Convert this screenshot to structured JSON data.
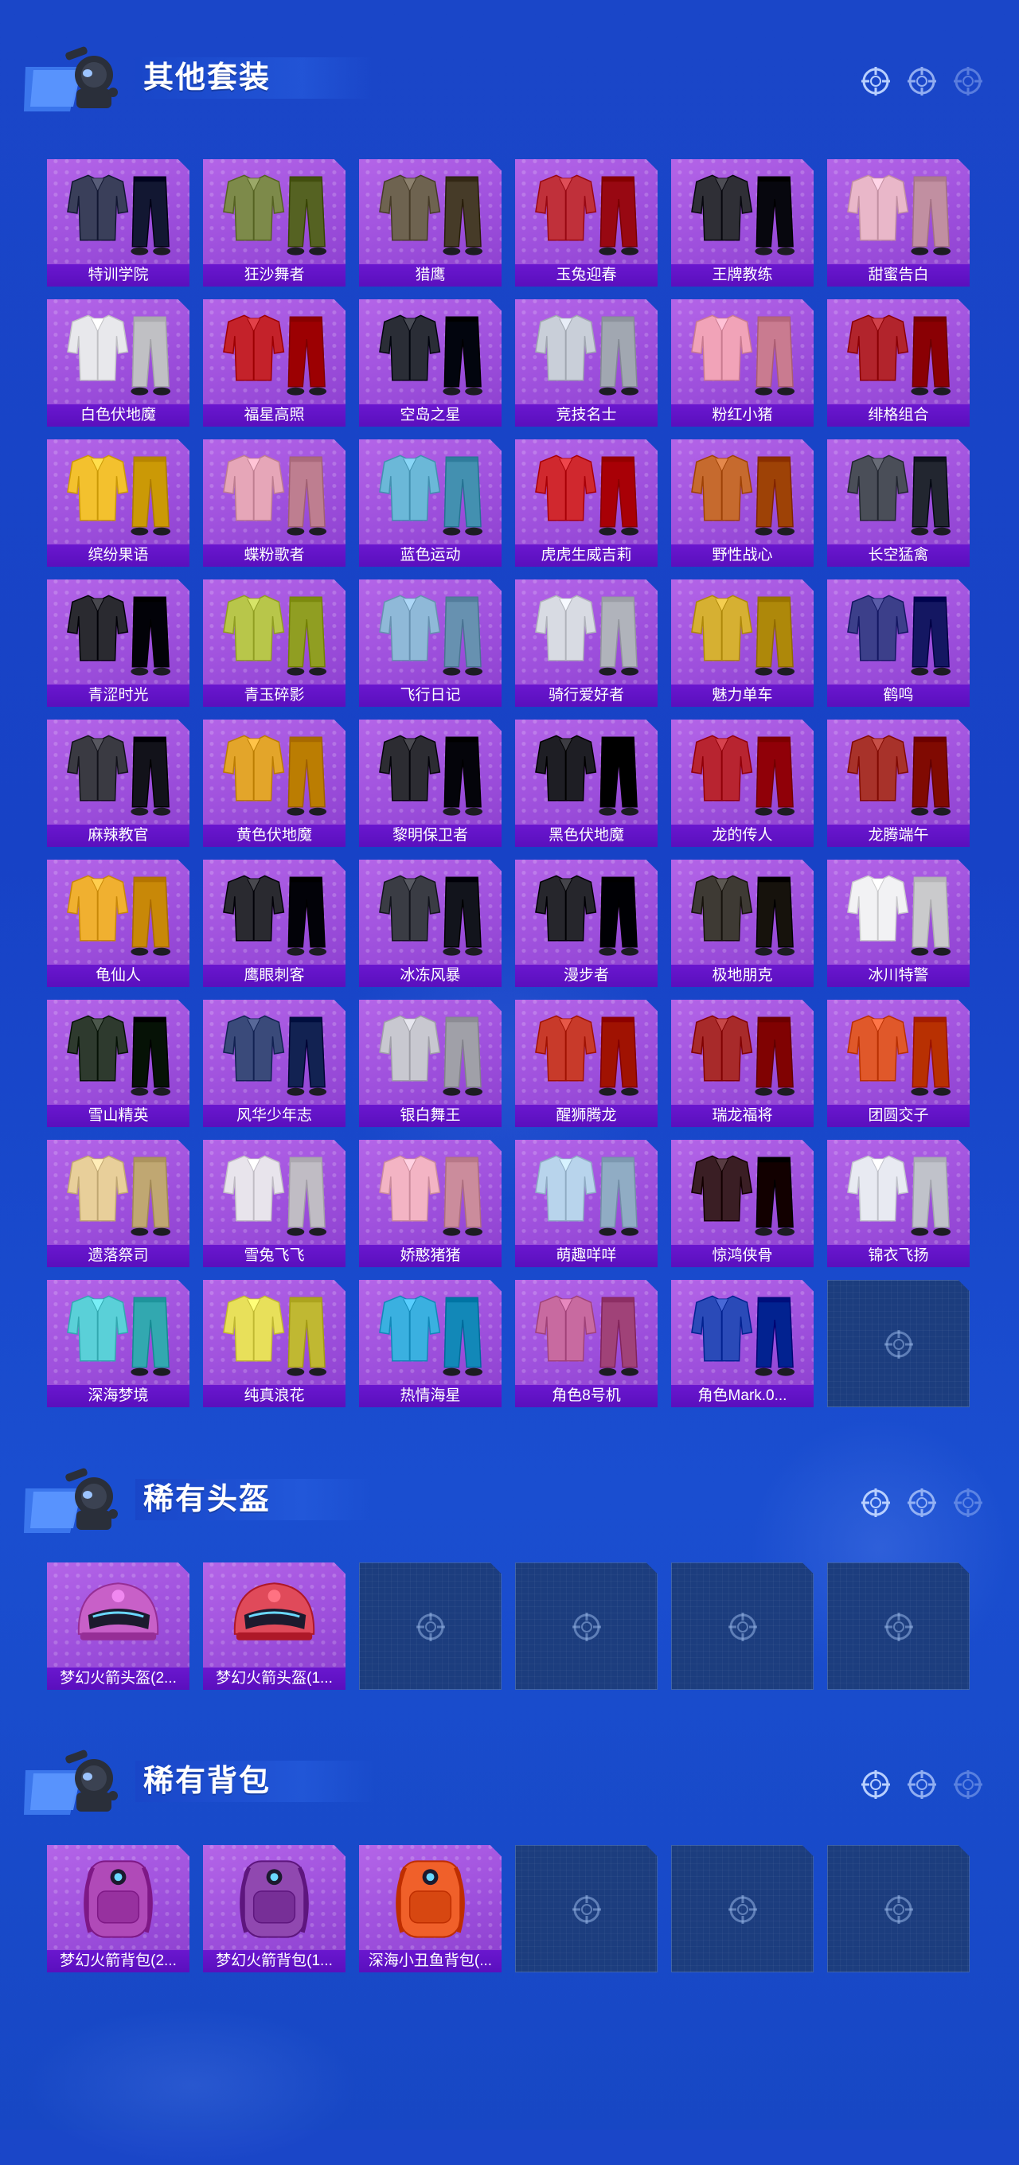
{
  "sections": [
    {
      "title": "其他套装",
      "items": [
        {
          "label": "特训学院",
          "kind": "outfit",
          "color": "#3a3f5a"
        },
        {
          "label": "狂沙舞者",
          "kind": "outfit",
          "color": "#7d8a4a"
        },
        {
          "label": "猎鹰",
          "kind": "outfit",
          "color": "#6e6350"
        },
        {
          "label": "玉兔迎春",
          "kind": "outfit",
          "color": "#c0303a"
        },
        {
          "label": "王牌教练",
          "kind": "outfit",
          "color": "#2f2f36"
        },
        {
          "label": "甜蜜告白",
          "kind": "outfit",
          "color": "#e9b7c9"
        },
        {
          "label": "白色伏地魔",
          "kind": "outfit",
          "color": "#e8e8ec"
        },
        {
          "label": "福星高照",
          "kind": "outfit",
          "color": "#c4222a"
        },
        {
          "label": "空岛之星",
          "kind": "outfit",
          "color": "#2a2d36"
        },
        {
          "label": "竞技名士",
          "kind": "outfit",
          "color": "#c9cfd9"
        },
        {
          "label": "粉红小猪",
          "kind": "outfit",
          "color": "#f1a3b8"
        },
        {
          "label": "绯格组合",
          "kind": "outfit",
          "color": "#b2242c"
        },
        {
          "label": "缤纷果语",
          "kind": "outfit",
          "color": "#f3c12e"
        },
        {
          "label": "蝶粉歌者",
          "kind": "outfit",
          "color": "#e6a6b8"
        },
        {
          "label": "蓝色运动",
          "kind": "outfit",
          "color": "#6bb8d8"
        },
        {
          "label": "虎虎生威吉莉",
          "kind": "outfit",
          "color": "#d0282e"
        },
        {
          "label": "野性战心",
          "kind": "outfit",
          "color": "#c66a2e"
        },
        {
          "label": "长空猛禽",
          "kind": "outfit",
          "color": "#4a4e58"
        },
        {
          "label": "青涩时光",
          "kind": "outfit",
          "color": "#2a2a30"
        },
        {
          "label": "青玉碎影",
          "kind": "outfit",
          "color": "#b8c64a"
        },
        {
          "label": "飞行日记",
          "kind": "outfit",
          "color": "#8fb9d8"
        },
        {
          "label": "骑行爱好者",
          "kind": "outfit",
          "color": "#d8dbe3"
        },
        {
          "label": "魅力单车",
          "kind": "outfit",
          "color": "#d6b032"
        },
        {
          "label": "鹤鸣",
          "kind": "outfit",
          "color": "#3c3f8a"
        },
        {
          "label": "麻辣教官",
          "kind": "outfit",
          "color": "#3a3a42"
        },
        {
          "label": "黄色伏地魔",
          "kind": "outfit",
          "color": "#e3a52a"
        },
        {
          "label": "黎明保卫者",
          "kind": "outfit",
          "color": "#2c2c32"
        },
        {
          "label": "黑色伏地魔",
          "kind": "outfit",
          "color": "#1e1e24"
        },
        {
          "label": "龙的传人",
          "kind": "outfit",
          "color": "#b82430"
        },
        {
          "label": "龙腾端午",
          "kind": "outfit",
          "color": "#a8322a"
        },
        {
          "label": "龟仙人",
          "kind": "outfit",
          "color": "#f0b030"
        },
        {
          "label": "鹰眼刺客",
          "kind": "outfit",
          "color": "#2a2a30"
        },
        {
          "label": "冰冻风暴",
          "kind": "outfit",
          "color": "#3a3c44"
        },
        {
          "label": "漫步者",
          "kind": "outfit",
          "color": "#26262c"
        },
        {
          "label": "极地朋克",
          "kind": "outfit",
          "color": "#3e3a34"
        },
        {
          "label": "冰川特警",
          "kind": "outfit",
          "color": "#f2f2f4"
        },
        {
          "label": "雪山精英",
          "kind": "outfit",
          "color": "#2e3a2e"
        },
        {
          "label": "风华少年志",
          "kind": "outfit",
          "color": "#3a4a7a"
        },
        {
          "label": "银白舞王",
          "kind": "outfit",
          "color": "#c8c8d0"
        },
        {
          "label": "醒狮腾龙",
          "kind": "outfit",
          "color": "#c83a2a"
        },
        {
          "label": "瑞龙福将",
          "kind": "outfit",
          "color": "#a82a2a"
        },
        {
          "label": "团圆交子",
          "kind": "outfit",
          "color": "#e0582a"
        },
        {
          "label": "遗落祭司",
          "kind": "outfit",
          "color": "#e8cf9a"
        },
        {
          "label": "雪兔飞飞",
          "kind": "outfit",
          "color": "#e8e4ec"
        },
        {
          "label": "娇憨猪猪",
          "kind": "outfit",
          "color": "#f3b4c4"
        },
        {
          "label": "萌趣咩咩",
          "kind": "outfit",
          "color": "#b8d4ec"
        },
        {
          "label": "惊鸿侠骨",
          "kind": "outfit",
          "color": "#3a1e24"
        },
        {
          "label": "锦衣飞扬",
          "kind": "outfit",
          "color": "#e8eaf2"
        },
        {
          "label": "深海梦境",
          "kind": "outfit",
          "color": "#5ad0d8"
        },
        {
          "label": "纯真浪花",
          "kind": "outfit",
          "color": "#e8e05a"
        },
        {
          "label": "热情海星",
          "kind": "outfit",
          "color": "#3ab0e0"
        },
        {
          "label": "角色8号机",
          "kind": "outfit",
          "color": "#c86aa0"
        },
        {
          "label": "角色Mark.0...",
          "kind": "outfit",
          "color": "#2a4ab8"
        },
        {
          "label": "",
          "kind": "empty",
          "color": ""
        }
      ]
    },
    {
      "title": "稀有头盔",
      "items": [
        {
          "label": "梦幻火箭头盔(2...",
          "kind": "helmet",
          "color": "#c860c8"
        },
        {
          "label": "梦幻火箭头盔(1...",
          "kind": "helmet",
          "color": "#e04a5a"
        },
        {
          "label": "",
          "kind": "empty",
          "color": ""
        },
        {
          "label": "",
          "kind": "empty",
          "color": ""
        },
        {
          "label": "",
          "kind": "empty",
          "color": ""
        },
        {
          "label": "",
          "kind": "empty",
          "color": ""
        }
      ]
    },
    {
      "title": "稀有背包",
      "items": [
        {
          "label": "梦幻火箭背包(2...",
          "kind": "backpack",
          "color": "#b04ab8"
        },
        {
          "label": "梦幻火箭背包(1...",
          "kind": "backpack",
          "color": "#9048b0"
        },
        {
          "label": "深海小丑鱼背包(...",
          "kind": "backpack",
          "color": "#f0602a"
        },
        {
          "label": "",
          "kind": "empty",
          "color": ""
        },
        {
          "label": "",
          "kind": "empty",
          "color": ""
        },
        {
          "label": "",
          "kind": "empty",
          "color": ""
        }
      ]
    }
  ],
  "icons": {
    "header_crosshair": "crosshair-icon",
    "empty_slot": "crosshair-icon",
    "mascot": "mascot-icon"
  },
  "colors": {
    "background": "#1a46c8",
    "card": "#a858e0",
    "label_bar": "#6314c8",
    "empty_slot": "#1c3d7e"
  }
}
